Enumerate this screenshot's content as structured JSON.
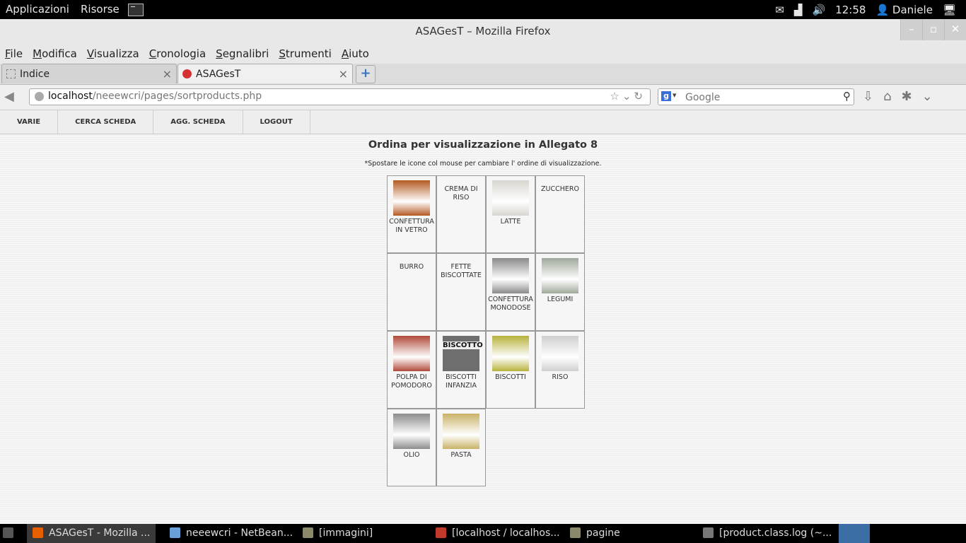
{
  "top_panel": {
    "menu": [
      "Applicazioni",
      "Risorse"
    ],
    "clock": "12:58",
    "user": "Daniele"
  },
  "window": {
    "title": "ASAGesT – Mozilla Firefox"
  },
  "menubar": [
    {
      "label": "File",
      "key": "F",
      "rest": "ile"
    },
    {
      "label": "Modifica",
      "key": "M",
      "rest": "odifica"
    },
    {
      "label": "Visualizza",
      "key": "V",
      "rest": "isualizza"
    },
    {
      "label": "Cronologia",
      "key": "C",
      "rest": "ronologia"
    },
    {
      "label": "Segnalibri",
      "key": "S",
      "rest": "egnalibri"
    },
    {
      "label": "Strumenti",
      "key": "S",
      "rest": "trumenti"
    },
    {
      "label": "Aiuto",
      "key": "A",
      "rest": "iuto"
    }
  ],
  "tabs": [
    {
      "label": "Indice",
      "close": "×"
    },
    {
      "label": "ASAGesT",
      "close": "×"
    }
  ],
  "newtab": "+",
  "nav": {
    "url_host": "localhost",
    "url_path": "/neeewcri/pages/sortproducts.php",
    "search_placeholder": "Google"
  },
  "site_menu": [
    "VARIE",
    "CERCA SCHEDA",
    "AGG. SCHEDA",
    "LOGOUT"
  ],
  "page": {
    "title": "Ordina per visualizzazione in Allegato 8",
    "hint": "*Spostare le icone col mouse per cambiare l' ordine di visualizzazione."
  },
  "products": [
    {
      "name": "CONFETTURA IN VETRO",
      "has_image": true,
      "image_color": "#b35a22"
    },
    {
      "name": "CREMA DI RISO",
      "has_image": false
    },
    {
      "name": "LATTE",
      "has_image": true,
      "image_color": "#d8d6d0"
    },
    {
      "name": "ZUCCHERO",
      "has_image": false
    },
    {
      "name": "BURRO",
      "has_image": false
    },
    {
      "name": "FETTE BISCOTTATE",
      "has_image": false
    },
    {
      "name": "CONFETTURA MONODOSE",
      "has_image": true,
      "image_color": "#8a8a8a"
    },
    {
      "name": "LEGUMI",
      "has_image": true,
      "image_color": "#9fa89a"
    },
    {
      "name": "POLPA DI POMODORO",
      "has_image": true,
      "image_color": "#b04a3a"
    },
    {
      "name": "BISCOTTI INFANZIA",
      "has_image": true,
      "image_color": "#6e6e6e",
      "image_text": "BISCOTTO"
    },
    {
      "name": "BISCOTTI",
      "has_image": true,
      "image_color": "#b7b23c"
    },
    {
      "name": "RISO",
      "has_image": true,
      "image_color": "#cfcfcf"
    },
    {
      "name": "OLIO",
      "has_image": true,
      "image_color": "#8c8c8c"
    },
    {
      "name": "PASTA",
      "has_image": true,
      "image_color": "#c9b267"
    }
  ],
  "taskbar": [
    {
      "label": "ASAGesT - Mozilla ...",
      "icon_color": "#e66000"
    },
    {
      "label": "neeewcri - NetBean...",
      "icon_color": "#6aa0d8"
    },
    {
      "label": "[immagini]",
      "icon_color": "#8a8a6a"
    },
    {
      "label": "[localhost / localhos...",
      "icon_color": "#c0392b"
    },
    {
      "label": "pagine",
      "icon_color": "#8a8a6a"
    },
    {
      "label": "[product.class.log (~...",
      "icon_color": "#777777"
    }
  ]
}
